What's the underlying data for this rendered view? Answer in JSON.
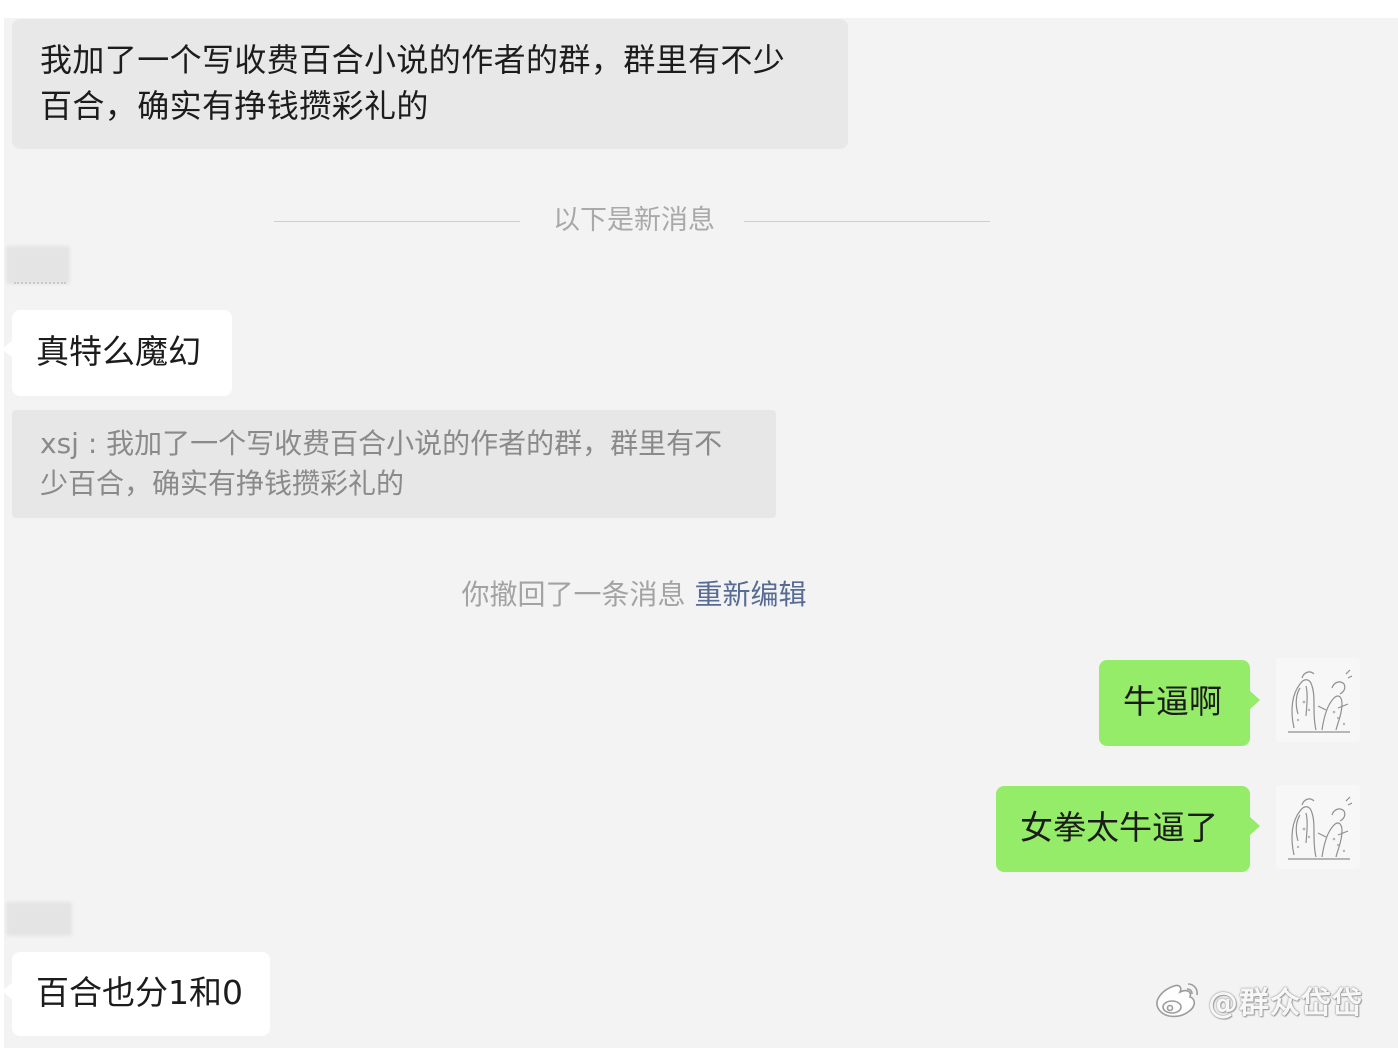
{
  "messages": {
    "m1": {
      "line1": "我加了一个写收费百合小说的作者的群，群里有不少",
      "line2": "百合，确实有挣钱攒彩礼的"
    },
    "m2": "真特么魔幻",
    "quote": {
      "line1": "xsj : 我加了一个写收费百合小说的作者的群，群里有不",
      "line2": "少百合，确实有挣钱攒彩礼的"
    },
    "m3": "牛逼啊",
    "m4": "女拳太牛逼了",
    "m5": "百合也分1和0"
  },
  "divider": {
    "label": "以下是新消息"
  },
  "recall": {
    "text": "你撤回了一条消息",
    "link": "重新编辑"
  },
  "watermark": {
    "text": "@群众岱岱"
  },
  "colors": {
    "chat_bg": "#f3f3f3",
    "received_bubble": "#ffffff",
    "received_bubble_gray": "#e8e8e8",
    "sent_bubble": "#95ec69",
    "link": "#576b95"
  },
  "icons": {
    "avatar": "avatar-sketch-image",
    "watermark_logo": "weibo-logo-icon"
  }
}
